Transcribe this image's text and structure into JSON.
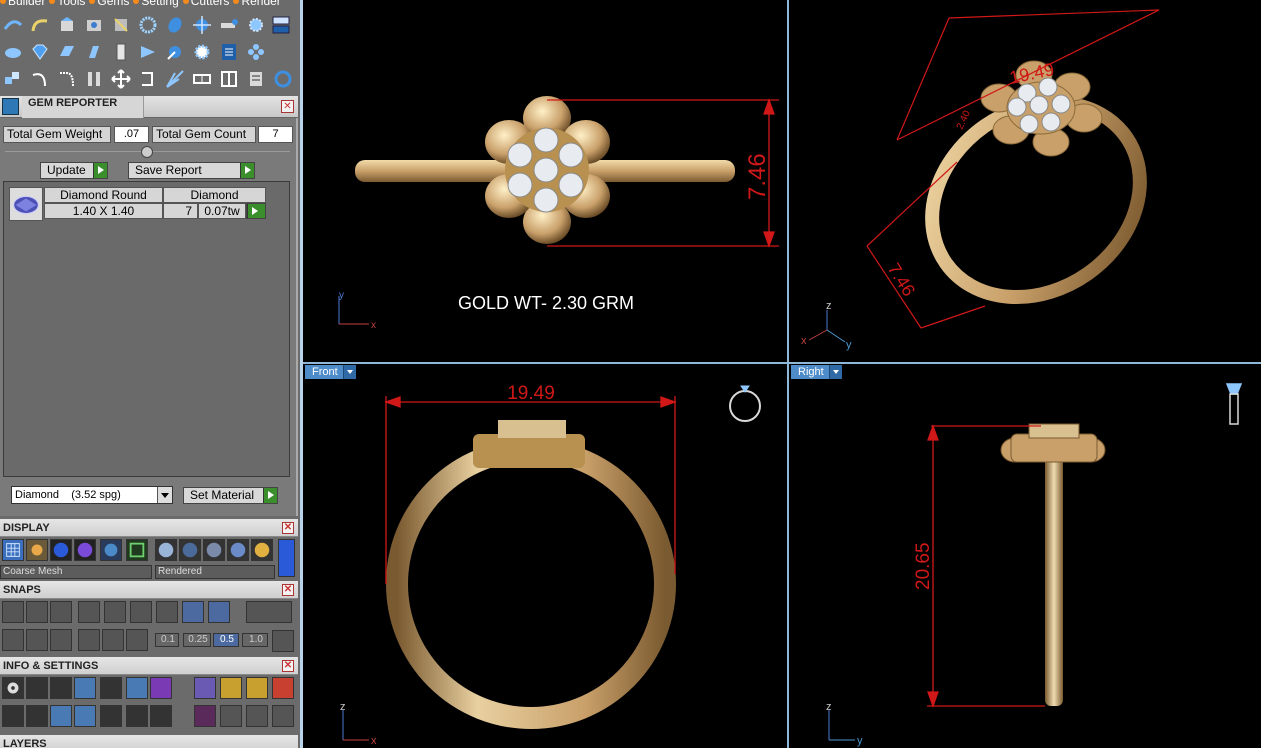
{
  "menu": [
    {
      "label": "Builder"
    },
    {
      "label": "Tools"
    },
    {
      "label": "Gems"
    },
    {
      "label": "Setting"
    },
    {
      "label": "Cutters"
    },
    {
      "label": "Render"
    }
  ],
  "gem_reporter": {
    "title": "GEM REPORTER",
    "total_weight_label": "Total Gem Weight",
    "total_weight_value": ".07",
    "total_count_label": "Total Gem Count",
    "total_count_value": "7",
    "update_label": "Update",
    "save_report_label": "Save Report",
    "table": {
      "col1_header": "Diamond Round",
      "col2_header": "Diamond",
      "size": "1.40 X 1.40",
      "count": "7",
      "weight": "0.07tw"
    },
    "material_select": "Diamond    (3.52 spg)",
    "set_material_label": "Set Material"
  },
  "display": {
    "title": "DISPLAY",
    "mesh_select": "Coarse Mesh",
    "render_select": "Rendered"
  },
  "snaps": {
    "title": "SNAPS",
    "values": [
      "0.1",
      "0.25",
      "0.5",
      "1.0"
    ],
    "active_value": "0.5"
  },
  "info_settings": {
    "title": "INFO & SETTINGS"
  },
  "layers": {
    "title": "LAYERS"
  },
  "viewports": {
    "top": {
      "annotation": "GOLD WT- 2.30 GRM",
      "dim_height": "7.46",
      "axis_x": "x",
      "axis_y": "y"
    },
    "perspective": {
      "dim_top": "19.49",
      "dim_side": "7.46",
      "dim_small": "2.40",
      "axis_x": "x",
      "axis_y": "y",
      "axis_z": "z"
    },
    "front": {
      "label": "Front",
      "dim_width": "19.49",
      "axis_z": "z",
      "axis_x": "x"
    },
    "right": {
      "label": "Right",
      "dim_height": "20.65",
      "axis_z": "z",
      "axis_y": "y"
    }
  },
  "colors": {
    "gold": "#c9a86a",
    "dimension": "#d01818",
    "viewport_border": "#8fb8d8",
    "panel": "#6b6b6b"
  }
}
